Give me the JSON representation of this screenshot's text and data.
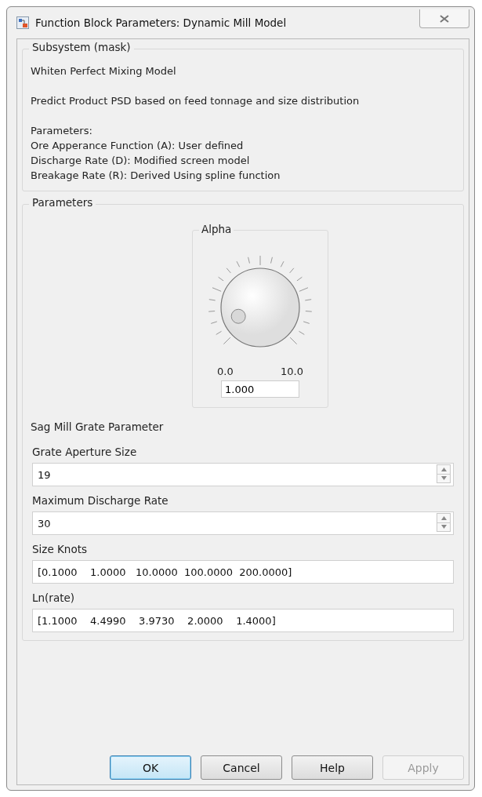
{
  "window": {
    "title": "Function Block Parameters: Dynamic Mill Model"
  },
  "description": {
    "title": "Subsystem (mask)",
    "heading": "Whiten Perfect Mixing Model",
    "summary": "Predict Product PSD based on feed tonnage and size distribution",
    "lines": [
      "Parameters:",
      "Ore Apperance Function (A): User defined",
      "Discharge Rate (D): Modified screen model",
      "Breakage Rate (R): Derived Using spline function"
    ]
  },
  "parameters": {
    "title": "Parameters",
    "knob": {
      "label": "Alpha",
      "min_label": "0.0",
      "max_label": "10.0",
      "value": "1.000"
    },
    "section_label": "Sag Mill Grate Parameter",
    "fields": [
      {
        "label": "Grate Aperture Size",
        "value": "19",
        "kind": "spin"
      },
      {
        "label": "Maximum Discharge Rate",
        "value": "30",
        "kind": "spin"
      },
      {
        "label": "Size Knots",
        "value": "[0.1000    1.0000   10.0000  100.0000  200.0000]",
        "kind": "text"
      },
      {
        "label": "Ln(rate)",
        "value": "[1.1000    4.4990    3.9730    2.0000    1.4000]",
        "kind": "text"
      }
    ]
  },
  "buttons": [
    {
      "label": "OK",
      "default": true,
      "disabled": false
    },
    {
      "label": "Cancel",
      "default": false,
      "disabled": false
    },
    {
      "label": "Help",
      "default": false,
      "disabled": false
    },
    {
      "label": "Apply",
      "default": false,
      "disabled": true
    }
  ]
}
